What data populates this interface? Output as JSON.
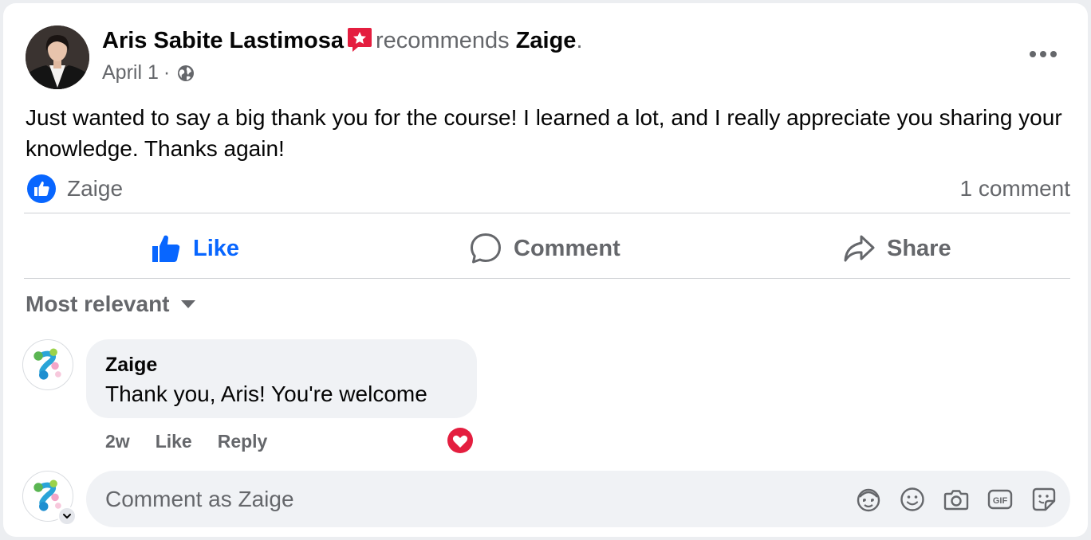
{
  "post": {
    "author": "Aris Sabite Lastimosa",
    "recommends_text": "recommends",
    "page_name": "Zaige",
    "period": ".",
    "date": "April 1",
    "separator": "·",
    "body": "Just wanted to say a big thank you for the course! I learned a lot, and I really appreciate you sharing your knowledge. Thanks again!"
  },
  "reactions": {
    "reactor": "Zaige",
    "comment_count": "1 comment"
  },
  "actions": {
    "like_label": "Like",
    "comment_label": "Comment",
    "share_label": "Share"
  },
  "comments": {
    "sort_label": "Most relevant",
    "items": [
      {
        "author": "Zaige",
        "text": "Thank you, Aris! You're welcome",
        "time": "2w",
        "like_label": "Like",
        "reply_label": "Reply",
        "reaction_icon": "heart-icon"
      }
    ]
  },
  "composer": {
    "placeholder": "Comment as Zaige",
    "icons": [
      "avatar-sticker-icon",
      "emoji-icon",
      "camera-icon",
      "gif-icon",
      "sticker-icon"
    ]
  },
  "colors": {
    "link_blue": "#0866ff",
    "secondary_text": "#65676b",
    "bubble_bg": "#f0f2f5",
    "recommend_red": "#e41e3f"
  }
}
